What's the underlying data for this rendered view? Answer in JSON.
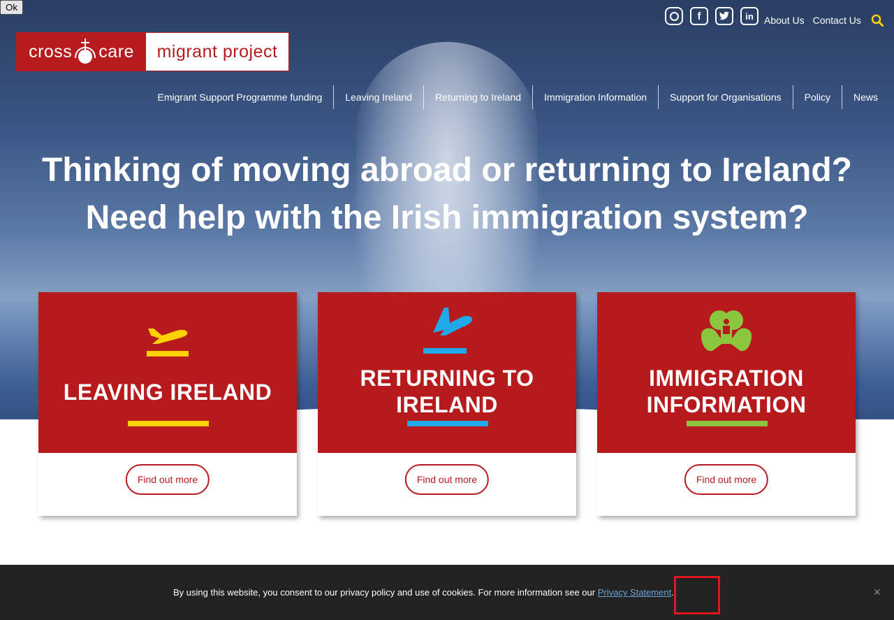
{
  "header": {
    "social": [
      "instagram-icon",
      "facebook-icon",
      "twitter-icon",
      "linkedin-icon"
    ],
    "top_links": [
      "About Us",
      "Contact Us"
    ],
    "logo": {
      "left_text_1": "cross",
      "left_text_2": "care",
      "right_text": "migrant project"
    }
  },
  "nav": {
    "items": [
      "Emigrant Support Programme funding",
      "Leaving Ireland",
      "Returning to Ireland",
      "Immigration Information",
      "Support for Organisations",
      "Policy",
      "News"
    ]
  },
  "hero": {
    "line1": "Thinking of moving abroad or returning to Ireland?",
    "line2": "Need help with the Irish immigration system?"
  },
  "cards": [
    {
      "title_1": "LEAVING IRELAND",
      "title_2": "",
      "button": "Find out more",
      "accent": "#ffd100",
      "icon": "plane-takeoff-icon"
    },
    {
      "title_1": "RETURNING TO",
      "title_2": "IRELAND",
      "button": "Find out more",
      "accent": "#1fa9e8",
      "icon": "plane-landing-icon"
    },
    {
      "title_1": "IMMIGRATION",
      "title_2": "INFORMATION",
      "button": "Find out more",
      "accent": "#8cc63f",
      "icon": "shamrock-icon"
    }
  ],
  "cookie": {
    "text": "By using this website, you consent to our privacy policy and use of cookies. For more information see our",
    "link": "Privacy Statement",
    "ok": "Ok"
  },
  "colors": {
    "brand_red": "#b71a1d",
    "cookie_bg": "#222222",
    "ok_blue": "#1e73be"
  }
}
